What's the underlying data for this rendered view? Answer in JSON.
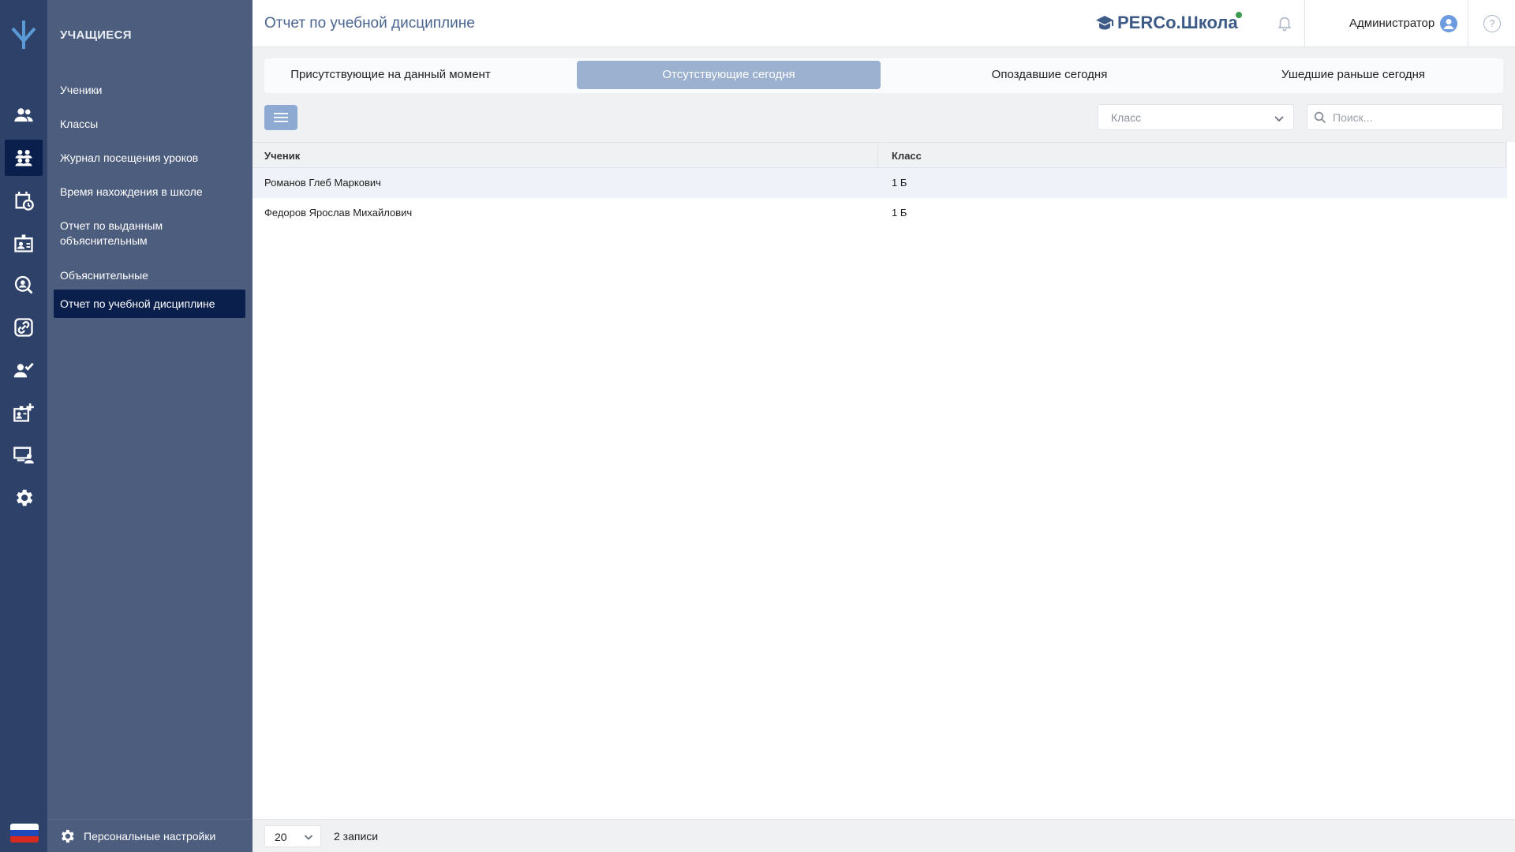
{
  "sidebar": {
    "section_title": "УЧАЩИЕСЯ",
    "items": [
      {
        "label": "Ученики"
      },
      {
        "label": "Классы"
      },
      {
        "label": "Журнал посещения уроков"
      },
      {
        "label": "Время нахождения в школе"
      },
      {
        "label": "Отчет по выданным объяснительным"
      },
      {
        "label": "Объяснительные"
      },
      {
        "label": "Отчет по учебной дисциплине"
      }
    ],
    "active_index": 6,
    "personal_settings": "Персональные настройки"
  },
  "rail": {
    "icons": [
      "users-icon",
      "students-icon",
      "calendar-clock-icon",
      "id-card-icon",
      "search-user-icon",
      "link-icon",
      "user-check-icon",
      "badge-add-icon",
      "devices-user-icon",
      "gear-icon"
    ],
    "active_index": 1
  },
  "header": {
    "title": "Отчет по учебной дисциплине",
    "brand": "PERCo.Школа",
    "user": "Администратор",
    "help": "?"
  },
  "tabs": [
    {
      "label": "Присутствующие на данный момент"
    },
    {
      "label": "Отсутствующие сегодня"
    },
    {
      "label": "Опоздавшие сегодня"
    },
    {
      "label": "Ушедшие раньше сегодня"
    }
  ],
  "active_tab": 1,
  "filters": {
    "class_select": "Класс",
    "search_placeholder": "Поиск..."
  },
  "table": {
    "columns": [
      "Ученик",
      "Класс"
    ],
    "rows": [
      {
        "student": "Романов Глеб Маркович",
        "class": "1 Б"
      },
      {
        "student": "Федоров Ярослав Михайлович",
        "class": "1 Б"
      }
    ]
  },
  "footer": {
    "page_size": "20",
    "records": "2 записи"
  },
  "colors": {
    "rail": "#2e4168",
    "sidebar": "#4c5d7e",
    "active_nav": "#0b1f4d",
    "active_tab": "#9cb1d0",
    "brand": "#3e5a86"
  }
}
